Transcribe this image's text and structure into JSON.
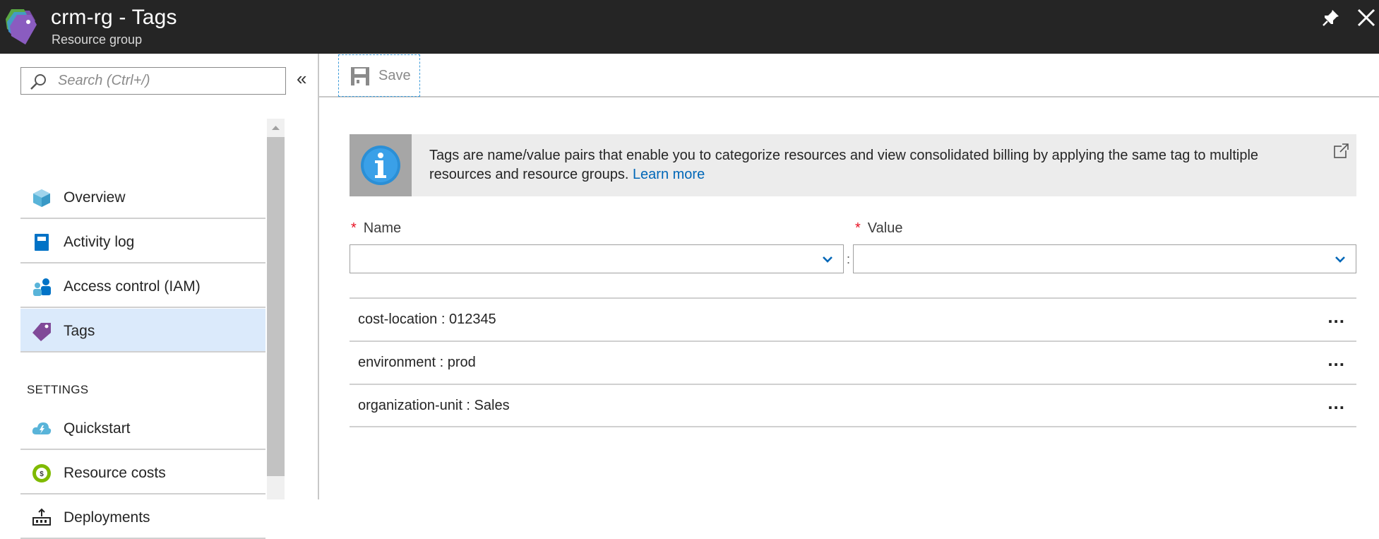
{
  "titlebar": {
    "title": "crm-rg - Tags",
    "subtitle": "Resource group",
    "icons": [
      "resource-group-tag-icon",
      "pin-icon",
      "close-icon"
    ]
  },
  "search": {
    "placeholder": "Search (Ctrl+/)",
    "value": ""
  },
  "sidebar": {
    "collapse_glyph": "«",
    "items": [
      {
        "label": "Overview",
        "icon": "overview-cube-icon",
        "active": false
      },
      {
        "label": "Activity log",
        "icon": "activity-log-book-icon",
        "active": false
      },
      {
        "label": "Access control (IAM)",
        "icon": "access-control-people-icon",
        "active": false
      },
      {
        "label": "Tags",
        "icon": "tag-icon",
        "active": true
      }
    ],
    "section_settings": "SETTINGS",
    "settings_items": [
      {
        "label": "Quickstart",
        "icon": "quickstart-cloud-icon"
      },
      {
        "label": "Resource costs",
        "icon": "resource-costs-coin-icon"
      },
      {
        "label": "Deployments",
        "icon": "deployments-icon"
      }
    ]
  },
  "toolbar": {
    "save_label": "Save"
  },
  "info": {
    "text": "Tags are name/value pairs that enable you to categorize resources and view consolidated billing by applying the same tag to multiple resources and resource groups.",
    "link": "Learn more"
  },
  "form": {
    "required_marker": "*",
    "name_label": "Name",
    "value_label": "Value",
    "separator": ":",
    "name_value": "",
    "value_value": ""
  },
  "tags": [
    {
      "text": "cost-location : 012345",
      "more": "..."
    },
    {
      "text": "environment : prod",
      "more": "..."
    },
    {
      "text": "organization-unit : Sales",
      "more": "..."
    }
  ],
  "colors": {
    "titlebar_bg": "#252525",
    "active_nav": "#dbeafb",
    "link": "#0067b8",
    "required": "#e81123",
    "info_bg": "#ececec"
  }
}
